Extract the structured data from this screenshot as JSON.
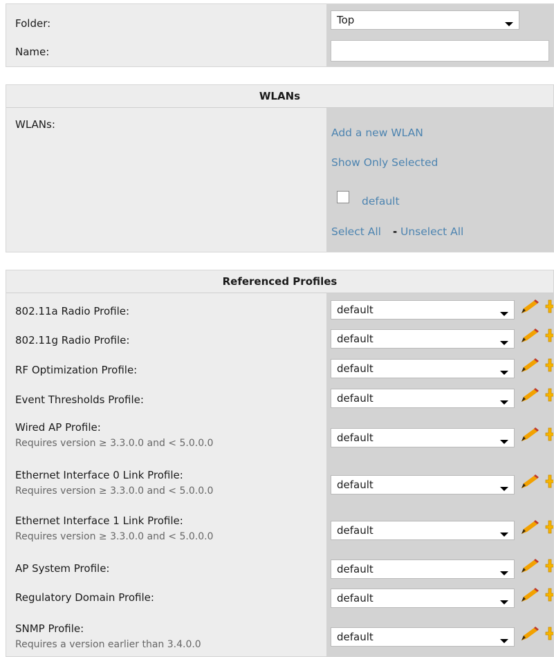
{
  "general": {
    "folder_label": "Folder:",
    "folder_value": "Top",
    "name_label": "Name:",
    "name_value": ""
  },
  "wlans": {
    "header": "WLANs",
    "label": "WLANs:",
    "add_link": "Add a new WLAN",
    "show_selected_link": "Show Only Selected",
    "item_label": "default",
    "item_checked": false,
    "select_all": "Select All",
    "separator": "-",
    "unselect_all": "Unselect All"
  },
  "profiles": {
    "header": "Referenced Profiles",
    "rows": [
      {
        "label": "802.11a Radio Profile:",
        "note": "",
        "value": "default"
      },
      {
        "label": "802.11g Radio Profile:",
        "note": "",
        "value": "default"
      },
      {
        "label": "RF Optimization Profile:",
        "note": "",
        "value": "default"
      },
      {
        "label": "Event Thresholds Profile:",
        "note": "",
        "value": "default"
      },
      {
        "label": "Wired AP Profile:",
        "note": "Requires version ≥ 3.3.0.0 and < 5.0.0.0",
        "value": "default"
      },
      {
        "label": "Ethernet Interface 0 Link Profile:",
        "note": "Requires version ≥ 3.3.0.0 and < 5.0.0.0",
        "value": "default"
      },
      {
        "label": "Ethernet Interface 1 Link Profile:",
        "note": "Requires version ≥ 3.3.0.0 and < 5.0.0.0",
        "value": "default"
      },
      {
        "label": "AP System Profile:",
        "note": "",
        "value": "default"
      },
      {
        "label": "Regulatory Domain Profile:",
        "note": "",
        "value": "default"
      },
      {
        "label": "SNMP Profile:",
        "note": "Requires a version earlier than 3.4.0.0",
        "value": "default"
      }
    ]
  },
  "icons": {
    "edit": "pencil-icon",
    "add": "plus-icon",
    "dropdown": "chevron-down-icon",
    "pencil_color": "#e08a00",
    "plus_color": "#f0a800"
  },
  "colors": {
    "link": "#4d84b0",
    "panel": "#ededed",
    "panel_right": "#d3d3d3"
  }
}
